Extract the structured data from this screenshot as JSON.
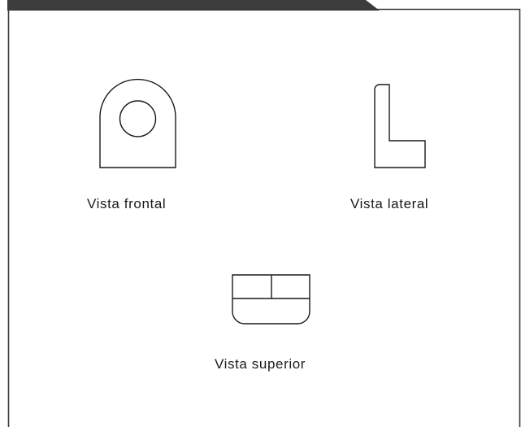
{
  "colors": {
    "frame": "#3a3a3a",
    "header_tab": "#3c3c3c",
    "stroke": "#1a1a1a",
    "background": "#ffffff"
  },
  "views": {
    "frontal": {
      "label": "Vista frontal"
    },
    "lateral": {
      "label": "Vista lateral"
    },
    "superior": {
      "label": "Vista superior"
    }
  }
}
